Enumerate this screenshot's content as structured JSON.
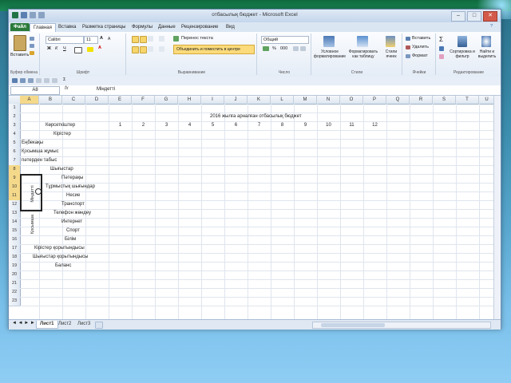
{
  "window": {
    "title": "отбасылық бюджет - Microsoft Excel",
    "controls": {
      "minimize": "–",
      "maximize": "□",
      "close": "✕"
    }
  },
  "tabs": [
    "Файл",
    "Главная",
    "Вставка",
    "Разметка страницы",
    "Формулы",
    "Данные",
    "Рецензирование",
    "Вид"
  ],
  "ribbon": {
    "clipboard": {
      "label": "Буфер обмена",
      "paste": "Вставить"
    },
    "font": {
      "label": "Шрифт",
      "font_name": "Calibri",
      "font_size": "11"
    },
    "alignment": {
      "label": "Выравнивание",
      "wrap": "Перенос текста",
      "merge": "Объединить и поместить в центре"
    },
    "number": {
      "label": "Число",
      "format": "Общий",
      "percent": "%",
      "thousands": "000"
    },
    "styles": {
      "label": "Стили",
      "conditional": "Условное форматирование",
      "as_table": "Форматировать как таблицу",
      "cell_styles": "Стили ячеек"
    },
    "cells": {
      "label": "Ячейки",
      "insert": "Вставить",
      "delete": "Удалить",
      "format": "Формат"
    },
    "editing": {
      "label": "Редактирование",
      "sort": "Сортировка и фильтр",
      "find": "Найти и выделить"
    }
  },
  "formula_bar": {
    "name_box": "A8",
    "fx": "fx",
    "value": "Міндетті"
  },
  "columns": [
    "A",
    "B",
    "C",
    "D",
    "E",
    "F",
    "G",
    "H",
    "I",
    "J",
    "K",
    "L",
    "M",
    "N",
    "O",
    "P",
    "Q",
    "R",
    "S",
    "T",
    "U"
  ],
  "rows": [
    "1",
    "2",
    "3",
    "4",
    "5",
    "6",
    "7",
    "8",
    "9",
    "10",
    "11",
    "12",
    "13",
    "14",
    "15",
    "16",
    "17",
    "18",
    "19",
    "20",
    "21",
    "22",
    "23"
  ],
  "cells": {
    "title": "2016 жылға арналған отбасылық бюджет",
    "header_label": "Көрсеткіштер",
    "months": [
      "1",
      "2",
      "3",
      "4",
      "5",
      "6",
      "7",
      "8",
      "9",
      "10",
      "11",
      "12"
    ],
    "kiris": "Кірістер",
    "enbekaky": "Еңбекақы",
    "kos_jumys": "Қосымша жұмыс",
    "pater": "пәтерден табыс",
    "shygys": "Шығыстар",
    "expenses": [
      "Пәтерақы",
      "Тұрмыстық шығындар",
      "Несие",
      "Транспорт",
      "Телефон жөндеу",
      "Интернет",
      "Спорт",
      "Білім"
    ],
    "kiris_total": "Кірістер қорытындысы",
    "shygys_total": "Шығыстар қорытындысы",
    "balans": "Баланс",
    "mindetti": "Міндетті",
    "kosymsha": "Қосымша"
  },
  "sheets": [
    "Лист1",
    "Лист2",
    "Лист3"
  ]
}
